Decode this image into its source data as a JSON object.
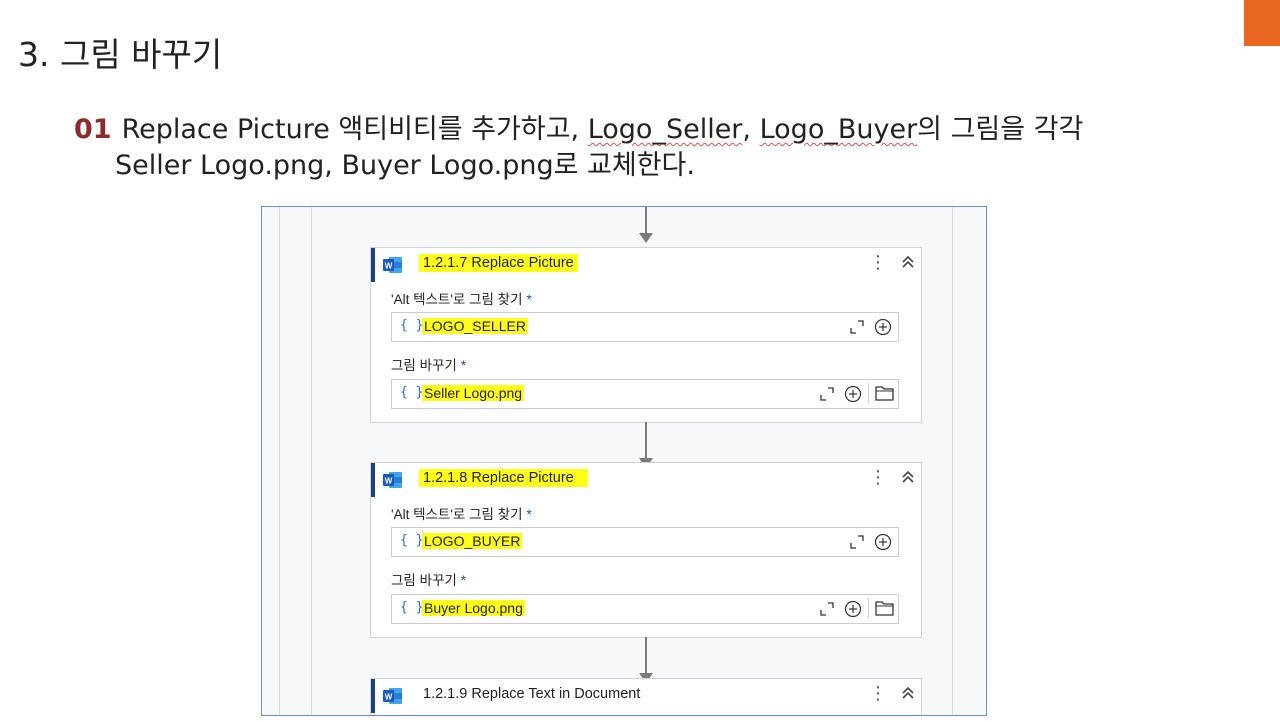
{
  "slide": {
    "title": "3. 그림 바꾸기",
    "step_number": "01",
    "instruction": {
      "part1": "Replace Picture 액티비티를 추가하고, ",
      "logo_seller": "Logo_Seller",
      "sep": ", ",
      "logo_buyer": "Logo_Buyer",
      "part2": "의 그림을 각각",
      "line2": "Seller Logo.png, Buyer Logo.png로 교체한다."
    }
  },
  "activities": [
    {
      "title": "1.2.1.7 Replace Picture",
      "find_label": "'Alt 텍스트'로 그림 찾기",
      "find_value": "LOGO_SELLER",
      "replace_label": "그림 바꾸기",
      "replace_value": "Seller Logo.png",
      "required_mark": "*",
      "brace": "{ }"
    },
    {
      "title": "1.2.1.8 Replace Picture",
      "find_label": "'Alt 텍스트'로 그림 찾기",
      "find_value": "LOGO_BUYER",
      "replace_label": "그림 바꾸기",
      "replace_value": "Buyer Logo.png",
      "required_mark": "*",
      "brace": "{ }"
    },
    {
      "title": "1.2.1.9 Replace Text in Document"
    }
  ],
  "icons": {
    "activity": "word-icon",
    "menu": "kebab-menu-icon",
    "collapse": "chevron-double-up-icon",
    "expand": "expand-icon",
    "add": "plus-circle-icon",
    "browse": "folder-icon"
  },
  "colors": {
    "accent": "#e8661f",
    "step_number": "#8b2b2b",
    "highlight": "#ffff1a",
    "activity_bar": "#1f3f80"
  }
}
